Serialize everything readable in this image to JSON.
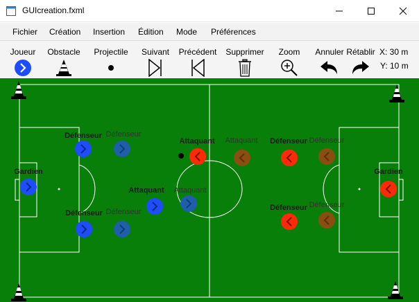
{
  "window": {
    "title": "GUIcreation.fxml",
    "icons": [
      "app-icon",
      "minimize-icon",
      "maximize-icon",
      "close-icon"
    ]
  },
  "menu": {
    "items": [
      "Fichier",
      "Création",
      "Insertion",
      "Édition",
      "Mode",
      "Préférences"
    ]
  },
  "toolbar": {
    "tools": [
      {
        "label": "Joueur",
        "icon": "player-icon"
      },
      {
        "label": "Obstacle",
        "icon": "cone-icon"
      },
      {
        "label": "Projectile",
        "icon": "ball-icon"
      },
      {
        "label": "Suivant",
        "icon": "next-frame-icon"
      },
      {
        "label": "Précédent",
        "icon": "previous-frame-icon"
      },
      {
        "label": "Supprimer",
        "icon": "trash-icon"
      },
      {
        "label": "Zoom",
        "icon": "zoom-icon"
      },
      {
        "label": "Annuler",
        "icon": "undo-icon"
      },
      {
        "label": "Rétablir",
        "icon": "redo-icon"
      }
    ],
    "coords": {
      "x": "X: 30 m",
      "y": "Y: 10 m"
    }
  },
  "field": {
    "colors": {
      "grass": "#087f08",
      "team_blue": "#1e4cff",
      "team_red": "#ff2a0a",
      "ghost_blue": "#1f5ea8",
      "ghost_red": "#8a4f10"
    },
    "players": [
      {
        "label": "Défenseur",
        "team": "blue",
        "ghost": false
      },
      {
        "label": "Défenseur",
        "team": "blue",
        "ghost": true
      },
      {
        "label": "Gardien",
        "team": "blue",
        "ghost": false
      },
      {
        "label": "Défenseur",
        "team": "blue",
        "ghost": false
      },
      {
        "label": "Défenseur",
        "team": "blue",
        "ghost": true
      },
      {
        "label": "Attaquant",
        "team": "blue",
        "ghost": false
      },
      {
        "label": "Attaquant",
        "team": "blue",
        "ghost": true
      },
      {
        "label": "Attaquant",
        "team": "red",
        "ghost": false
      },
      {
        "label": "Attaquant",
        "team": "red",
        "ghost": true
      },
      {
        "label": "Défenseur",
        "team": "red",
        "ghost": false
      },
      {
        "label": "Défenseur",
        "team": "red",
        "ghost": true
      },
      {
        "label": "Gardien",
        "team": "red",
        "ghost": false
      },
      {
        "label": "Défenseur",
        "team": "red",
        "ghost": false
      },
      {
        "label": "Défenseur",
        "team": "red",
        "ghost": true
      }
    ]
  }
}
